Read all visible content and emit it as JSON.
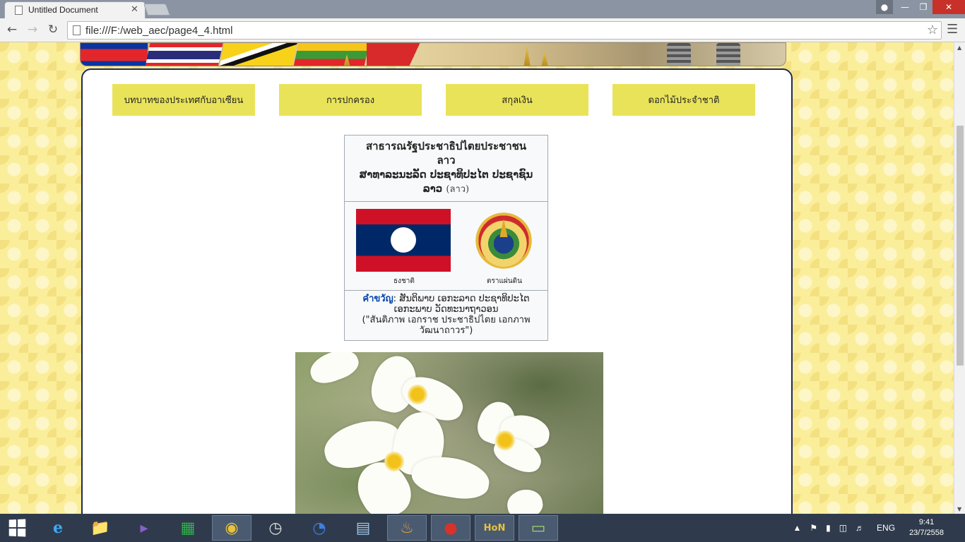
{
  "browser": {
    "tab_title": "Untitled Document",
    "tab_close": "✕",
    "url": "file:///F:/web_aec/page4_4.html"
  },
  "nav_tabs": [
    "บทบาทของประเทศกับอาเซียน",
    "การปกครอง",
    "สกุลเงิน",
    "ดอกไม้ประจำชาติ"
  ],
  "infobox": {
    "name_thai_line1": "สาธารณรัฐประชาธิปไตยประชาชน",
    "name_thai_line2": "ลาว",
    "name_lao_line1": "ສາທາລະນະລັດ ປະຊາທິປະໄຕ ປະຊາຊົນ",
    "name_lao_line2": "ລາວ",
    "name_lang_note": "(ลาว)",
    "flag_caption": "ธงชาติ",
    "emblem_caption": "ตราแผ่นดิน",
    "motto_label": "คำขวัญ",
    "motto_sep": ":",
    "motto_lao": "ສັນຕິພາບ ເອກະລາດ ປະຊາທິປະໄຕ ເອກະພາບ ວັດທະນາຖາວອນ",
    "motto_thai": "(\"สันติภาพ เอกราช ประชาธิปไตย เอกภาพ วัฒนาถาวร\")"
  },
  "taskbar": {
    "language": "ENG",
    "time": "9:41",
    "date": "23/7/2558"
  },
  "colors": {
    "nav_tab_bg": "#e9e35a",
    "card_border": "#1f2a5a",
    "page_bg": "#fbee9b"
  }
}
